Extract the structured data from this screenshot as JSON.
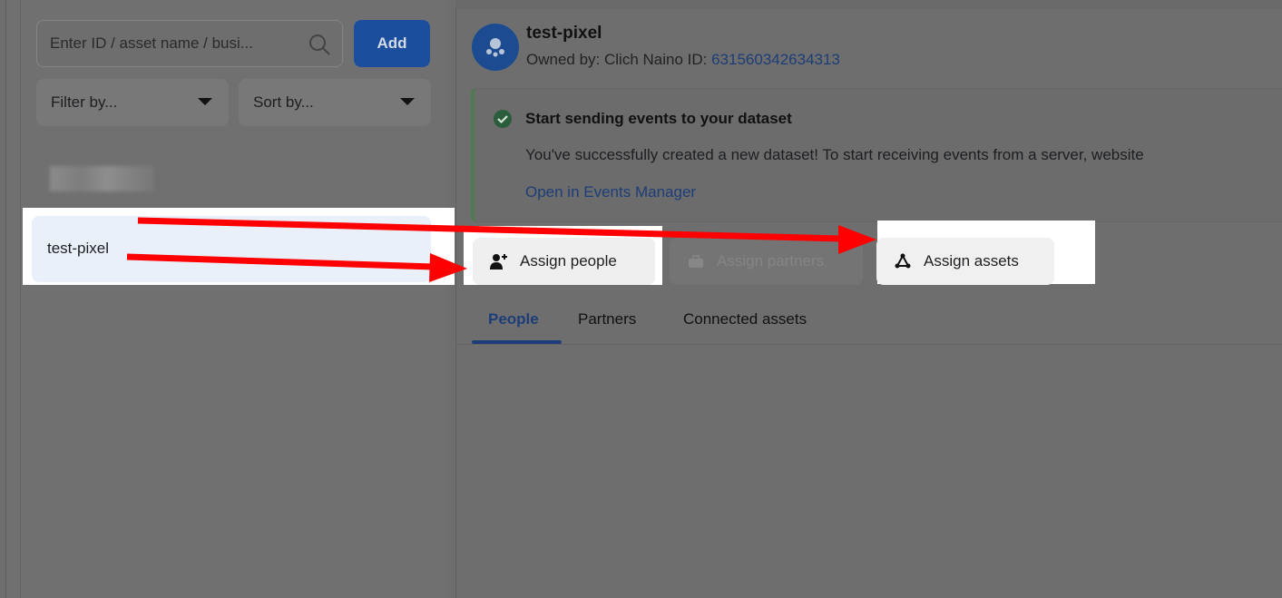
{
  "search": {
    "placeholder": "Enter ID / asset name / busi..."
  },
  "add_label": "Add",
  "filter_label": "Filter by...",
  "sort_label": "Sort by...",
  "list": {
    "selected_item": "test-pixel"
  },
  "asset": {
    "title": "test-pixel",
    "owner_prefix": "Owned by: Clich Naino  ID: ",
    "id": "631560342634313"
  },
  "banner": {
    "title": "Start sending events to your dataset",
    "text": "You've successfully created a new dataset! To start receiving events from a server, website",
    "link": "Open in Events Manager"
  },
  "actions": {
    "assign_people": "Assign people",
    "assign_partners": "Assign partners",
    "assign_assets": "Assign assets"
  },
  "tabs": [
    "People",
    "Partners",
    "Connected assets"
  ],
  "colors": {
    "accent": "#1b4f9e",
    "annotation_arrow": "#ff0000",
    "success": "#2e7d32"
  },
  "icons": [
    "search-icon",
    "caret-down-icon",
    "check-circle-icon",
    "add-person-icon",
    "briefcase-icon",
    "assets-triangle-icon",
    "dataset-avatar-icon"
  ]
}
